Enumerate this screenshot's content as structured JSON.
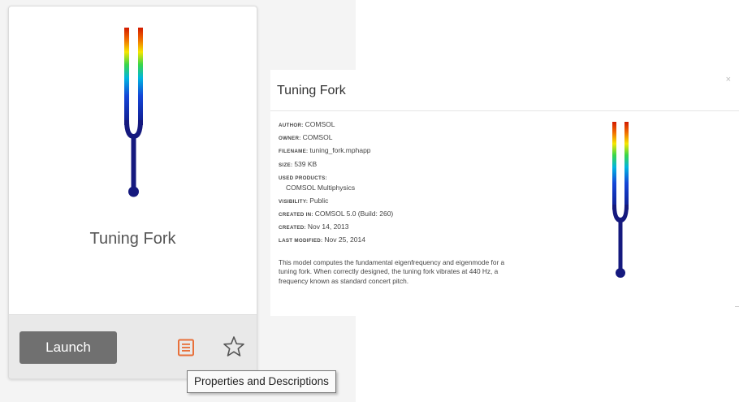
{
  "card": {
    "title": "Tuning Fork",
    "launch_label": "Launch",
    "properties_icon": "document-icon",
    "favorite_icon": "star-icon",
    "tooltip": "Properties and Descriptions",
    "colors": {
      "footer_bg": "#e9e9e9",
      "launch_bg": "#707070",
      "doc_icon": "#e8703a"
    }
  },
  "dialog": {
    "title": "Tuning Fork",
    "close_label": "×",
    "properties": [
      {
        "key": "AUTHOR:",
        "value": "COMSOL"
      },
      {
        "key": "OWNER:",
        "value": "COMSOL"
      },
      {
        "key": "FILENAME:",
        "value": "tuning_fork.mphapp"
      },
      {
        "key": "SIZE:",
        "value": "539 KB"
      },
      {
        "key": "USED PRODUCTS:",
        "value": "COMSOL Multiphysics"
      },
      {
        "key": "VISIBILITY:",
        "value": "Public"
      },
      {
        "key": "CREATED IN:",
        "value": "COMSOL 5.0 (Build: 260)"
      },
      {
        "key": "CREATED:",
        "value": "Nov 14, 2013"
      },
      {
        "key": "LAST MODIFIED:",
        "value": "Nov 25, 2014"
      }
    ],
    "description": "This model computes the fundamental eigenfrequency and eigenmode for a tuning fork. When correctly designed, the tuning fork vibrates at 440 Hz, a frequency known as standard concert pitch."
  }
}
